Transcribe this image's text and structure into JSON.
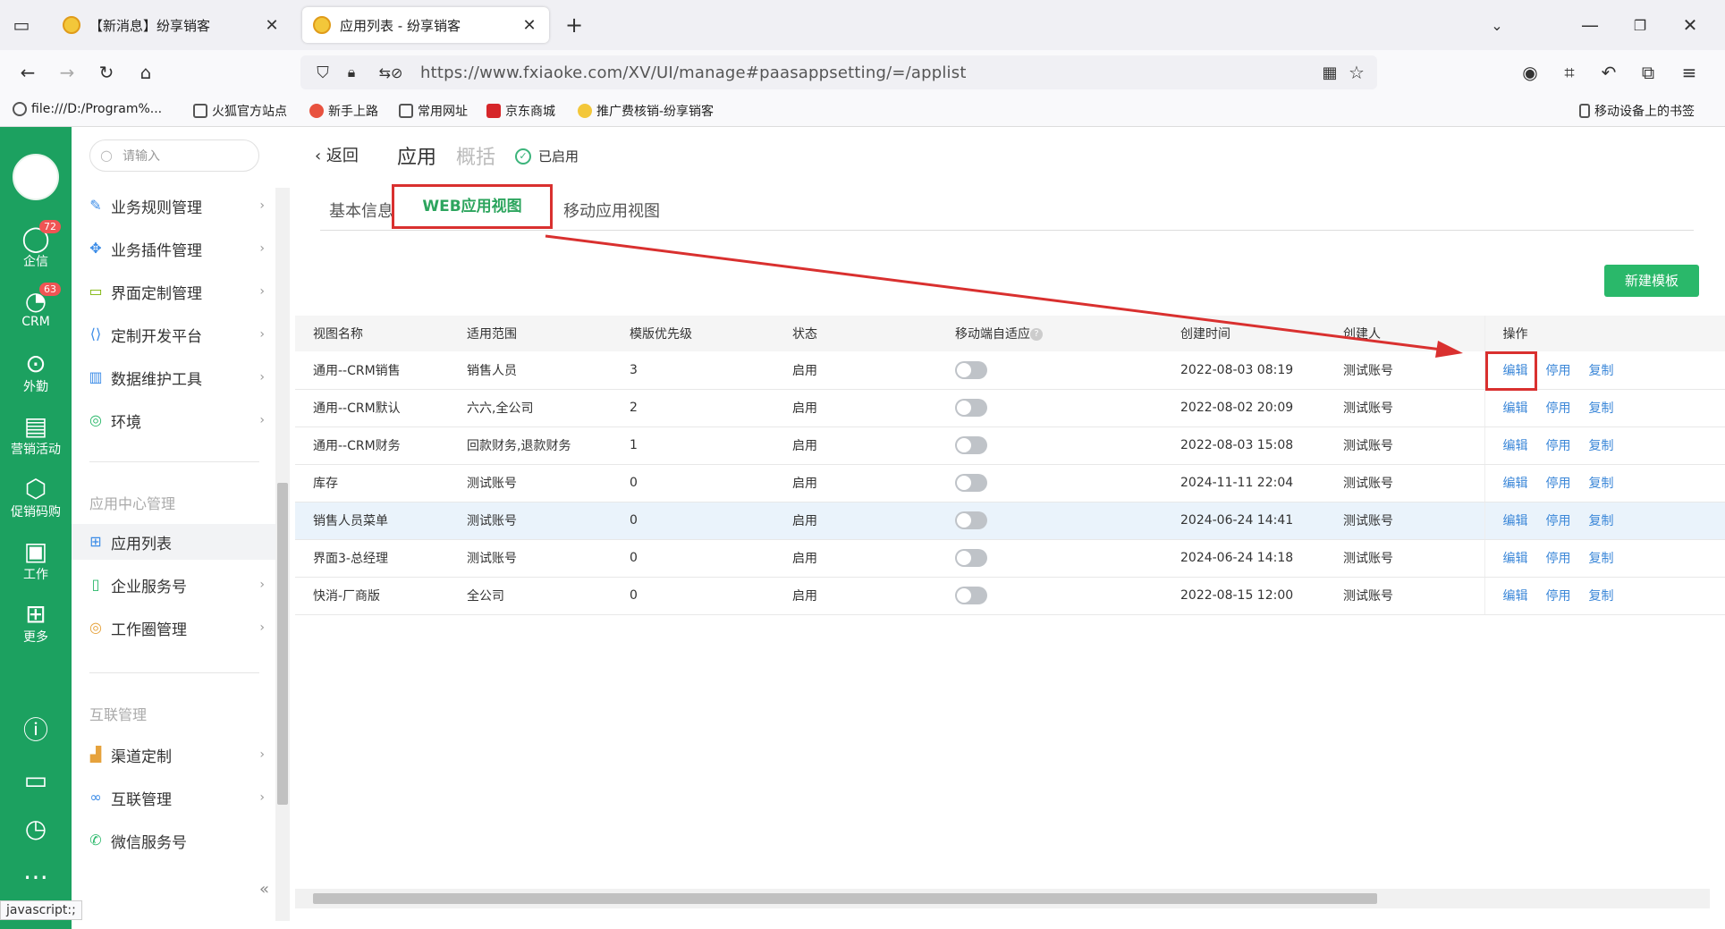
{
  "browser": {
    "tabs": [
      {
        "title": "【新消息】纷享销客",
        "active": false
      },
      {
        "title": "应用列表 - 纷享销客",
        "active": true
      }
    ],
    "url": "https://www.fxiaoke.com/XV/UI/manage#paasappsetting/=/applist",
    "bookmarks": [
      "file:///D:/Program%...",
      "火狐官方站点",
      "新手上路",
      "常用网址",
      "京东商城",
      "推广费核销-纷享销客"
    ],
    "mobile_bookmarks": "移动设备上的书签",
    "status_url": "javascript:;"
  },
  "rail": {
    "items": [
      {
        "label": "企信",
        "icon": "chat-icon",
        "badge": "72"
      },
      {
        "label": "CRM",
        "icon": "crm-icon",
        "badge": "63"
      },
      {
        "label": "外勤",
        "icon": "location-icon",
        "badge": ""
      },
      {
        "label": "营销活动",
        "icon": "marketing-icon",
        "badge": ""
      },
      {
        "label": "促销码购",
        "icon": "box-icon",
        "badge": ""
      },
      {
        "label": "工作",
        "icon": "work-icon",
        "badge": ""
      },
      {
        "label": "更多",
        "icon": "grid-icon",
        "badge": ""
      }
    ]
  },
  "sidebar": {
    "search_placeholder": "请输入",
    "items": [
      {
        "label": "业务规则管理",
        "icon": "rule-icon"
      },
      {
        "label": "业务插件管理",
        "icon": "plugin-icon"
      },
      {
        "label": "界面定制管理",
        "icon": "layout-icon"
      },
      {
        "label": "定制开发平台",
        "icon": "code-icon"
      },
      {
        "label": "数据维护工具",
        "icon": "chart-icon"
      },
      {
        "label": "环境",
        "icon": "env-icon"
      }
    ],
    "group1": "应用中心管理",
    "group1_items": [
      {
        "label": "应用列表",
        "icon": "app-grid-icon"
      },
      {
        "label": "企业服务号",
        "icon": "service-icon"
      },
      {
        "label": "工作圈管理",
        "icon": "circle-icon"
      }
    ],
    "group2": "互联管理",
    "group2_items": [
      {
        "label": "渠道定制",
        "icon": "channel-icon"
      },
      {
        "label": "互联管理",
        "icon": "link-icon"
      },
      {
        "label": "微信服务号",
        "icon": "wechat-icon"
      }
    ]
  },
  "main": {
    "back_label": "返回",
    "title": "应用",
    "overview": "概括",
    "status": "已启用",
    "subtabs": [
      "基本信息",
      "WEB应用视图",
      "移动应用视图"
    ],
    "new_button": "新建模板",
    "columns": [
      "视图名称",
      "适用范围",
      "模版优先级",
      "状态",
      "移动端自适应",
      "创建时间",
      "创建人",
      "操作"
    ],
    "actions": [
      "编辑",
      "停用",
      "复制"
    ],
    "rows": [
      {
        "name": "通用--CRM销售",
        "scope": "销售人员",
        "priority": "3",
        "status": "启用",
        "created": "2022-08-03 08:19",
        "creator": "测试账号"
      },
      {
        "name": "通用--CRM默认",
        "scope": "六六,全公司",
        "priority": "2",
        "status": "启用",
        "created": "2022-08-02 20:09",
        "creator": "测试账号"
      },
      {
        "name": "通用--CRM财务",
        "scope": "回款财务,退款财务",
        "priority": "1",
        "status": "启用",
        "created": "2022-08-03 15:08",
        "creator": "测试账号"
      },
      {
        "name": "库存",
        "scope": "测试账号",
        "priority": "0",
        "status": "启用",
        "created": "2024-11-11 22:04",
        "creator": "测试账号"
      },
      {
        "name": "销售人员菜单",
        "scope": "测试账号",
        "priority": "0",
        "status": "启用",
        "created": "2024-06-24 14:41",
        "creator": "测试账号"
      },
      {
        "name": "界面3-总经理",
        "scope": "测试账号",
        "priority": "0",
        "status": "启用",
        "created": "2024-06-24 14:18",
        "creator": "测试账号"
      },
      {
        "name": "快消-厂商版",
        "scope": "全公司",
        "priority": "0",
        "status": "启用",
        "created": "2022-08-15 12:00",
        "creator": "测试账号"
      }
    ]
  }
}
